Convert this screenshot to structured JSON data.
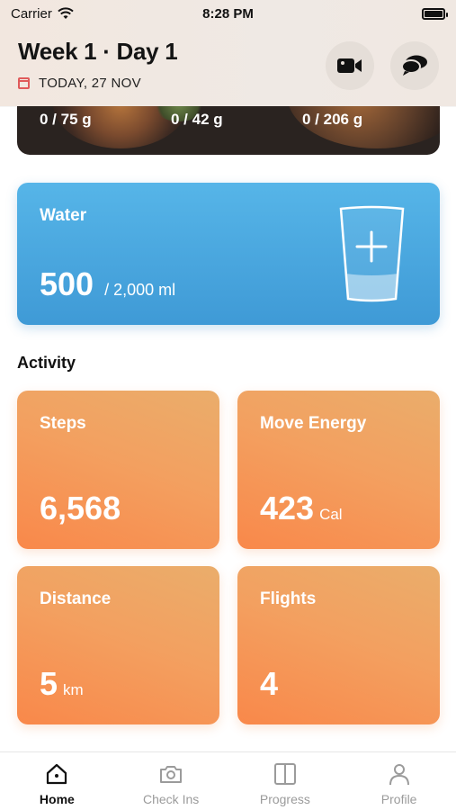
{
  "status_bar": {
    "carrier": "Carrier",
    "time": "8:28 PM"
  },
  "header": {
    "title": "Week 1 · Day 1",
    "date": "TODAY, 27 NOV"
  },
  "food": {
    "macros": [
      "0 / 75 g",
      "0 / 42 g",
      "0 / 206 g"
    ]
  },
  "water": {
    "title": "Water",
    "value": "500",
    "target": "/  2,000 ml"
  },
  "activity": {
    "title": "Activity",
    "steps": {
      "title": "Steps",
      "value": "6,568",
      "unit": ""
    },
    "move_energy": {
      "title": "Move Energy",
      "value": "423",
      "unit": "Cal"
    },
    "distance": {
      "title": "Distance",
      "value": "5",
      "unit": "km"
    },
    "flights": {
      "title": "Flights",
      "value": "4",
      "unit": ""
    }
  },
  "tabs": [
    {
      "label": "Home",
      "icon": "home-icon",
      "active": true
    },
    {
      "label": "Check Ins",
      "icon": "camera-icon",
      "active": false
    },
    {
      "label": "Progress",
      "icon": "progress-icon",
      "active": false
    },
    {
      "label": "Profile",
      "icon": "person-icon",
      "active": false
    }
  ],
  "colors": {
    "water": "#4aa7e0",
    "activity": "#f59a58",
    "accent_red": "#e05a5a"
  }
}
